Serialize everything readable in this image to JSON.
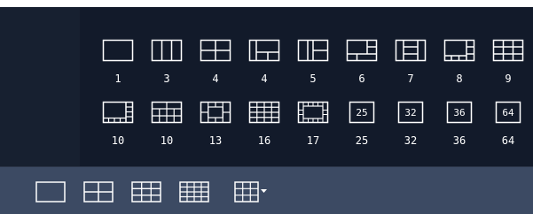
{
  "layout_picker": {
    "row1": [
      {
        "label": "1",
        "icon": "layout-1-icon"
      },
      {
        "label": "3",
        "icon": "layout-3-icon"
      },
      {
        "label": "4",
        "icon": "layout-4-icon"
      },
      {
        "label": "4",
        "icon": "layout-4b-icon"
      },
      {
        "label": "5",
        "icon": "layout-5-icon"
      },
      {
        "label": "6",
        "icon": "layout-6-icon"
      },
      {
        "label": "7",
        "icon": "layout-7-icon"
      },
      {
        "label": "8",
        "icon": "layout-8-icon"
      },
      {
        "label": "9",
        "icon": "layout-9-icon"
      }
    ],
    "row2": [
      {
        "label": "10",
        "icon": "layout-10-icon"
      },
      {
        "label": "10",
        "icon": "layout-10b-icon"
      },
      {
        "label": "13",
        "icon": "layout-13-icon"
      },
      {
        "label": "16",
        "icon": "layout-16-icon"
      },
      {
        "label": "17",
        "icon": "layout-17-icon"
      },
      {
        "label": "25",
        "icon": "layout-25-icon",
        "box_text": "25"
      },
      {
        "label": "32",
        "icon": "layout-32-icon",
        "box_text": "32"
      },
      {
        "label": "36",
        "icon": "layout-36-icon",
        "box_text": "36"
      },
      {
        "label": "64",
        "icon": "layout-64-icon",
        "box_text": "64"
      }
    ]
  },
  "toolbar": {
    "buttons": [
      {
        "icon": "single-view-icon"
      },
      {
        "icon": "quad-view-icon"
      },
      {
        "icon": "nine-view-icon"
      },
      {
        "icon": "sixteen-view-icon"
      },
      {
        "icon": "more-layouts-dropdown-icon"
      }
    ]
  },
  "colors": {
    "panel_bg": "#121a2a",
    "toolbar_bg": "#3c4a63",
    "icon_stroke": "#ffffff"
  }
}
